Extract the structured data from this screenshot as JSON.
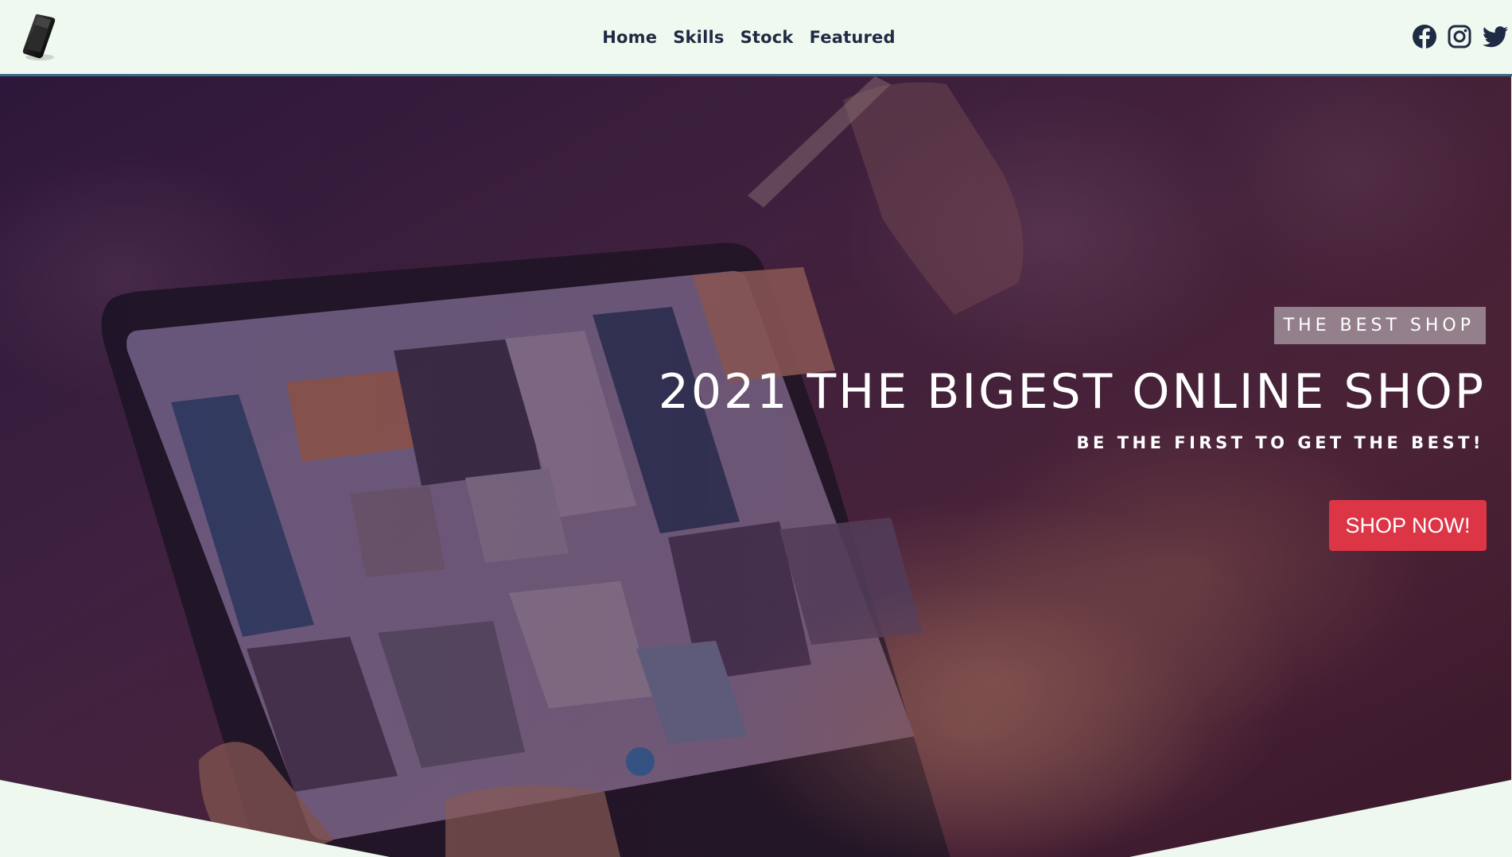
{
  "nav": {
    "links": [
      "Home",
      "Skills",
      "Stock",
      "Featured"
    ],
    "social": [
      "facebook-icon",
      "instagram-icon",
      "twitter-icon"
    ]
  },
  "hero": {
    "tag": "THE BEST SHOP",
    "headline": "2021 THE BIGEST ONLINE SHOP",
    "subline": "BE THE FIRST TO GET THE BEST!",
    "cta": "SHOP NOW!"
  },
  "colors": {
    "nav_bg": "#f0f9ef",
    "nav_text": "#1f2a44",
    "nav_border": "#3d6b86",
    "cta": "#dc3545",
    "overlay": "#4a2436"
  }
}
